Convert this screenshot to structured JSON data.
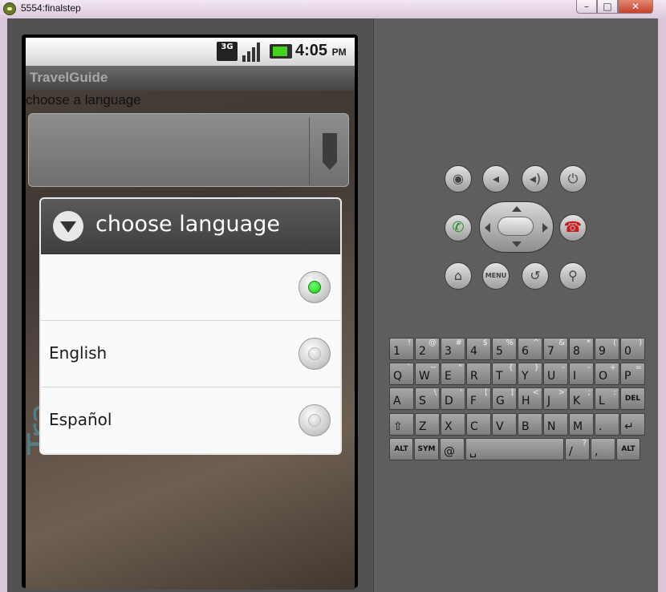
{
  "window": {
    "title": "5554:finalstep",
    "minimize": "–",
    "maximize": "□",
    "close": "✕"
  },
  "status_bar": {
    "network": "3G",
    "time": "4:05",
    "ampm": "PM"
  },
  "app": {
    "title": "TravelGuide",
    "prompt": "choose a language",
    "overlay_text": "Tra"
  },
  "dialog": {
    "title": "choose language",
    "options": [
      {
        "label": "",
        "selected": true
      },
      {
        "label": "English",
        "selected": false
      },
      {
        "label": "Español",
        "selected": false
      }
    ]
  },
  "controls": {
    "camera": "camera-icon",
    "vol_down": "volume-down-icon",
    "vol_up": "volume-up-icon",
    "power": "power-icon",
    "call": "call-icon",
    "end": "end-call-icon",
    "home": "home-icon",
    "menu": "MENU",
    "back": "back-icon",
    "search": "search-icon"
  },
  "keyboard": {
    "rows": [
      [
        [
          "1",
          "!"
        ],
        [
          "2",
          "@"
        ],
        [
          "3",
          "#"
        ],
        [
          "4",
          "$"
        ],
        [
          "5",
          "%"
        ],
        [
          "6",
          "^"
        ],
        [
          "7",
          "&"
        ],
        [
          "8",
          "*"
        ],
        [
          "9",
          "("
        ],
        [
          "0",
          ")"
        ]
      ],
      [
        [
          "Q",
          "`"
        ],
        [
          "W",
          "~"
        ],
        [
          "E",
          "\""
        ],
        [
          "R",
          ""
        ],
        [
          "T",
          "{"
        ],
        [
          "Y",
          "}"
        ],
        [
          "U",
          "-"
        ],
        [
          "I",
          "-"
        ],
        [
          "O",
          "+"
        ],
        [
          "P",
          "="
        ]
      ],
      [
        [
          "A",
          ""
        ],
        [
          "S",
          "\\"
        ],
        [
          "D",
          "'"
        ],
        [
          "F",
          "["
        ],
        [
          "G",
          "]"
        ],
        [
          "H",
          "<"
        ],
        [
          "J",
          ">"
        ],
        [
          "K",
          ";"
        ],
        [
          "L",
          ":"
        ],
        [
          "DEL",
          ""
        ]
      ],
      [
        [
          "⇧",
          ""
        ],
        [
          "Z",
          ""
        ],
        [
          "X",
          ""
        ],
        [
          "C",
          ""
        ],
        [
          "V",
          ""
        ],
        [
          "B",
          ""
        ],
        [
          "N",
          ""
        ],
        [
          "M",
          ""
        ],
        [
          ".",
          ""
        ],
        [
          "↵",
          ""
        ]
      ],
      [
        [
          "ALT",
          ""
        ],
        [
          "SYM",
          ""
        ],
        [
          "@",
          ""
        ],
        [
          "␣",
          ""
        ],
        [
          "/",
          "?"
        ],
        [
          ",",
          ""
        ],
        [
          "ALT",
          ""
        ]
      ]
    ]
  }
}
